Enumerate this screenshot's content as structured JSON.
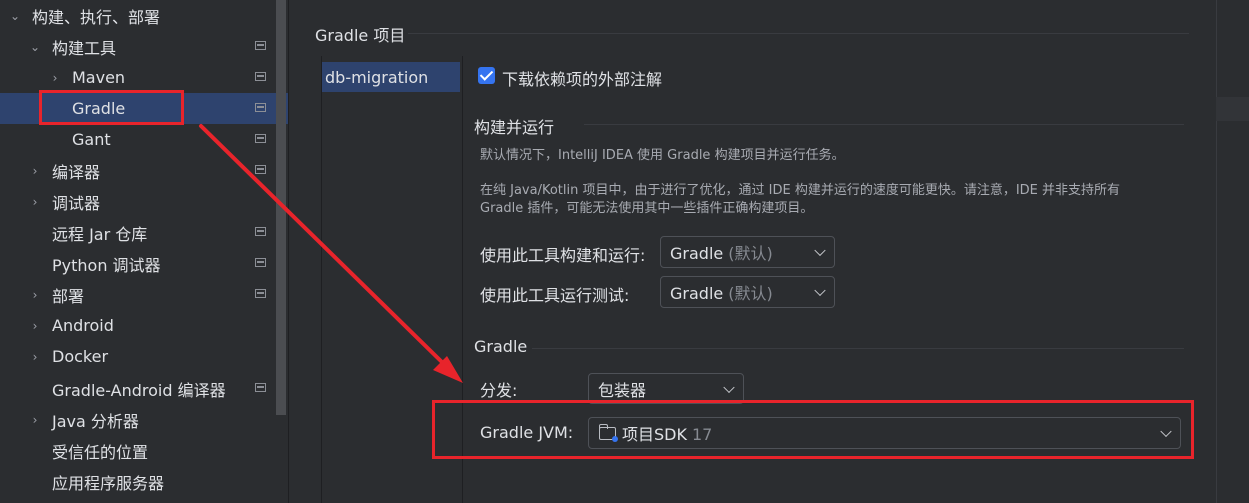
{
  "sidebar": {
    "items": [
      {
        "label": "构建、执行、部署",
        "expanded": true
      },
      {
        "label": "构建工具",
        "expanded": true
      },
      {
        "label": "Maven"
      },
      {
        "label": "Gradle",
        "selected": true
      },
      {
        "label": "Gant"
      },
      {
        "label": "编译器"
      },
      {
        "label": "调试器"
      },
      {
        "label": "远程 Jar 仓库"
      },
      {
        "label": "Python 调试器"
      },
      {
        "label": "部署"
      },
      {
        "label": "Android"
      },
      {
        "label": "Docker"
      },
      {
        "label": "Gradle-Android 编译器"
      },
      {
        "label": "Java 分析器"
      },
      {
        "label": "受信任的位置"
      },
      {
        "label": "应用程序服务器"
      }
    ]
  },
  "main": {
    "section_title": "Gradle 项目",
    "project_list": [
      "db-migration"
    ],
    "download_annotations": {
      "label": "下载依赖项的外部注解",
      "checked": true
    },
    "build_run": {
      "title": "构建并运行",
      "desc1": "默认情况下，IntelliJ IDEA 使用 Gradle 构建项目并运行任务。",
      "desc2_line1": "在纯 Java/Kotlin 项目中，由于进行了优化，通过 IDE 构建并运行的速度可能更快。请注意，IDE 并非支持所有",
      "desc2_line2": "Gradle 插件，可能无法使用其中一些插件正确构建项目。",
      "build_with_label": "使用此工具构建和运行:",
      "build_with_value": "Gradle",
      "build_with_hint": "(默认)",
      "test_with_label": "使用此工具运行测试:",
      "test_with_value": "Gradle",
      "test_with_hint": "(默认)"
    },
    "gradle": {
      "title": "Gradle",
      "distribution_label": "分发:",
      "distribution_value": "包装器",
      "jvm_label": "Gradle JVM:",
      "jvm_value": "项目SDK",
      "jvm_version": "17"
    }
  },
  "colors": {
    "accent": "#3574f0",
    "selection": "#2e436e",
    "annotation": "#e8242b"
  }
}
